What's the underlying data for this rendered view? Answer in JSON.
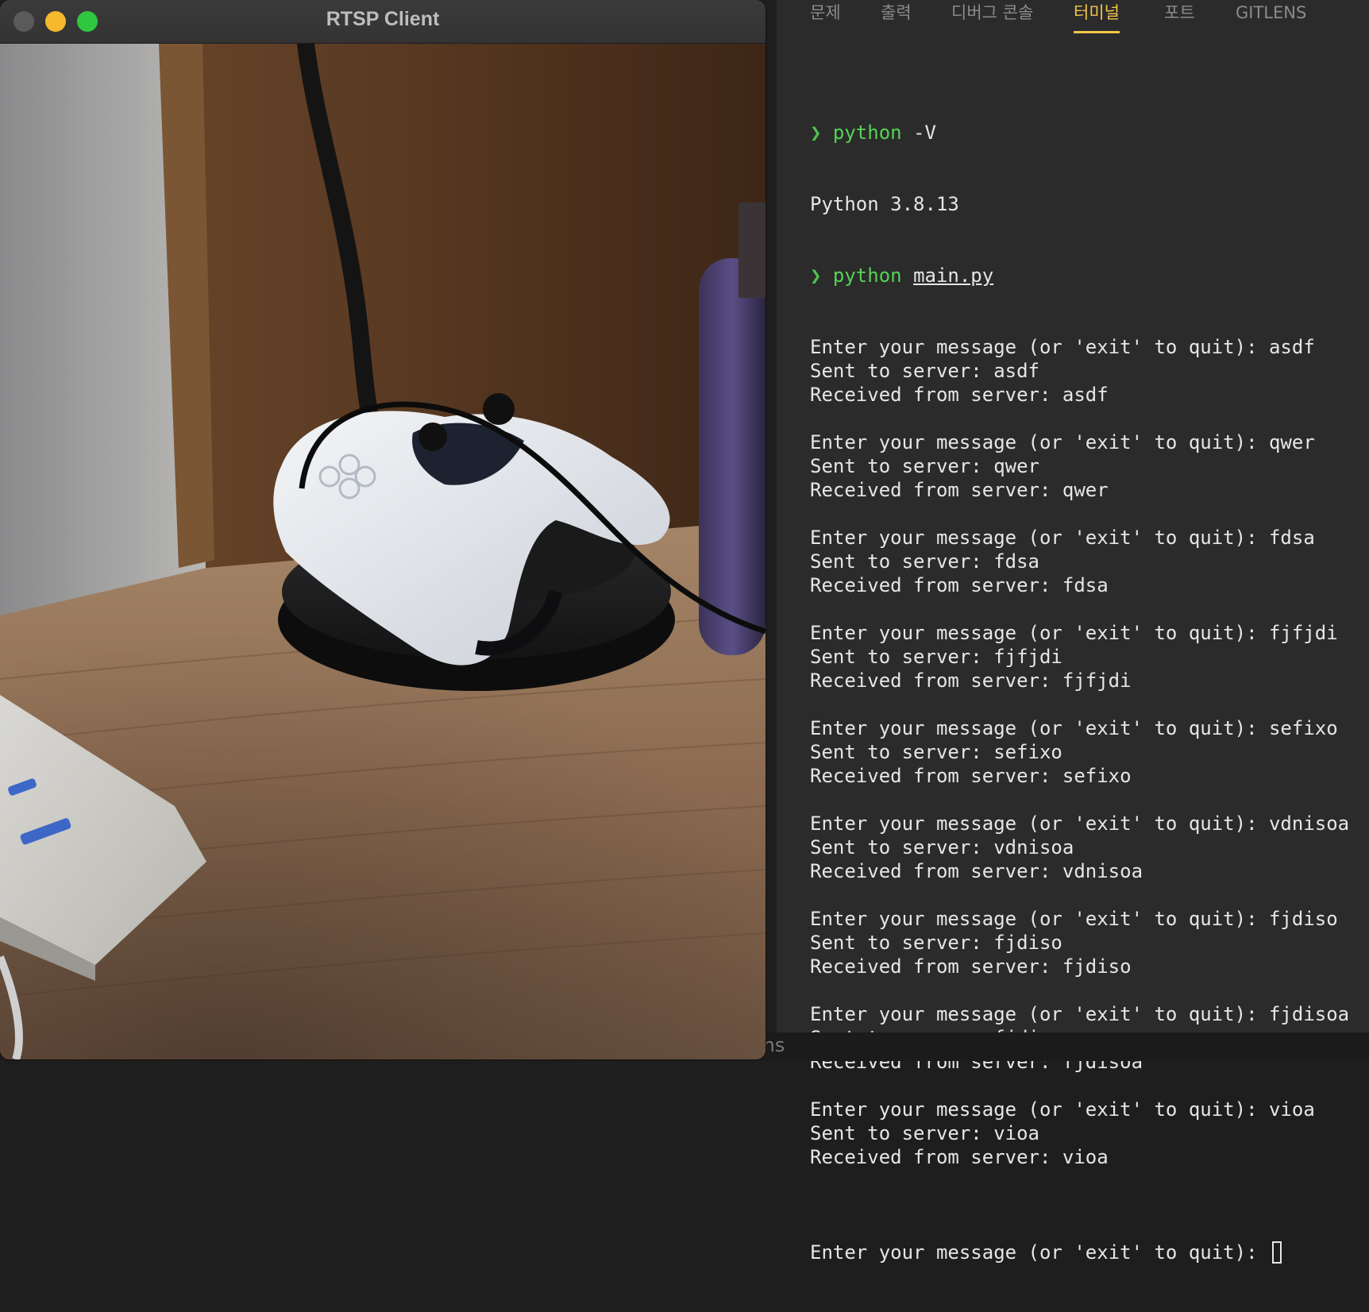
{
  "window": {
    "title": "RTSP Client",
    "buttons": [
      "close",
      "minimize",
      "maximize"
    ]
  },
  "panel": {
    "tabs": [
      {
        "label": "문제"
      },
      {
        "label": "출력"
      },
      {
        "label": "디버그 콘솔"
      },
      {
        "label": "터미널"
      },
      {
        "label": "포트"
      },
      {
        "label": "GITLENS"
      }
    ],
    "active_tab": "터미널"
  },
  "terminal": {
    "prompt_symbol": "❯",
    "cmd1": {
      "program": "python",
      "args": "-V"
    },
    "version_output": "Python 3.8.13",
    "cmd2": {
      "program": "python",
      "args": "main.py"
    },
    "exchanges": [
      {
        "prompt": "Enter your message (or 'exit' to quit): asdf",
        "sent": "Sent to server: asdf",
        "received": "Received from server: asdf"
      },
      {
        "prompt": "Enter your message (or 'exit' to quit): qwer",
        "sent": "Sent to server: qwer",
        "received": "Received from server: qwer"
      },
      {
        "prompt": "Enter your message (or 'exit' to quit): fdsa",
        "sent": "Sent to server: fdsa",
        "received": "Received from server: fdsa"
      },
      {
        "prompt": "Enter your message (or 'exit' to quit): fjfjdi",
        "sent": "Sent to server: fjfjdi",
        "received": "Received from server: fjfjdi"
      },
      {
        "prompt": "Enter your message (or 'exit' to quit): sefixo",
        "sent": "Sent to server: sefixo",
        "received": "Received from server: sefixo"
      },
      {
        "prompt": "Enter your message (or 'exit' to quit): vdnisoa",
        "sent": "Sent to server: vdnisoa",
        "received": "Received from server: vdnisoa"
      },
      {
        "prompt": "Enter your message (or 'exit' to quit): fjdiso",
        "sent": "Sent to server: fjdiso",
        "received": "Received from server: fjdiso"
      },
      {
        "prompt": "Enter your message (or 'exit' to quit): fjdisoa",
        "sent": "Sent to server: fjdisoa",
        "received": "Received from server: fjdisoa"
      },
      {
        "prompt": "Enter your message (or 'exit' to quit): vioa",
        "sent": "Sent to server: vioa",
        "received": "Received from server: vioa"
      }
    ],
    "final_prompt": "Enter your message (or 'exit' to quit):"
  },
  "status_fragment": "ins"
}
